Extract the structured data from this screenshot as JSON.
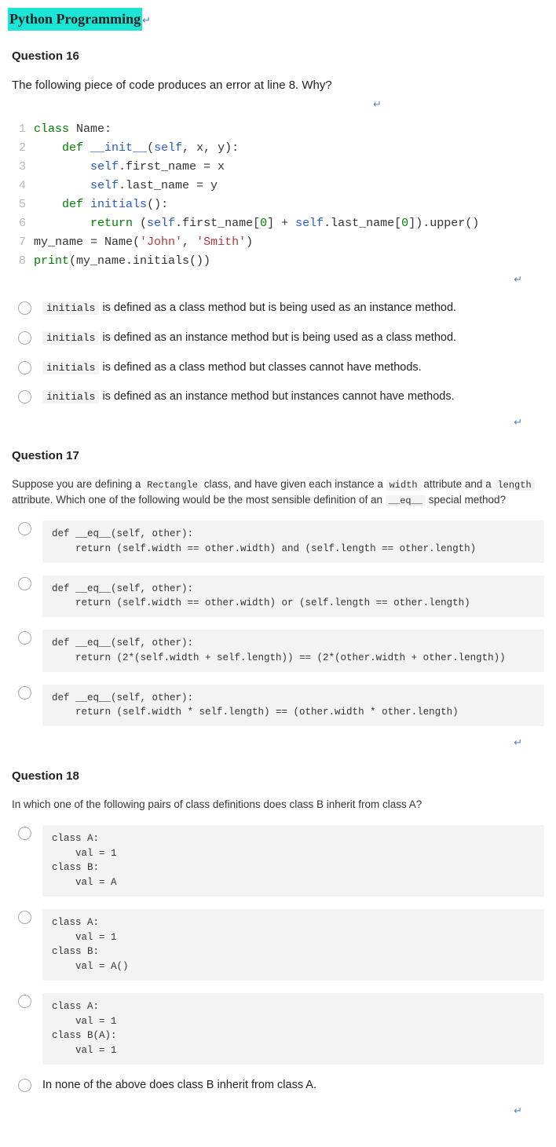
{
  "page_title": "Python Programming",
  "enter_glyph": "↵",
  "q16": {
    "heading": "Question 16",
    "prompt": "The following piece of code produces an error at line 8. Why?",
    "code": {
      "lines": [
        "1",
        "2",
        "3",
        "4",
        "5",
        "6",
        "7",
        "8"
      ]
    },
    "options": [
      {
        "code": "initials",
        "text": " is defined as a class method but is being used as an instance method."
      },
      {
        "code": "initials",
        "text": " is defined as an instance method but is being used as a class method."
      },
      {
        "code": "initials",
        "text": " is defined as a class method but classes cannot have methods."
      },
      {
        "code": "initials",
        "text": " is defined as an instance method but instances cannot have methods."
      }
    ]
  },
  "q17": {
    "heading": "Question 17",
    "prompt_pre": "Suppose you are defining a ",
    "prompt_c1": "Rectangle",
    "prompt_mid1": " class, and have given each instance a ",
    "prompt_c2": "width",
    "prompt_mid2": " attribute and a ",
    "prompt_c3": "length",
    "prompt_mid3": " attribute. Which one of the following would be the most sensible definition of an ",
    "prompt_c4": "__eq__",
    "prompt_post": " special method?",
    "options": [
      "def __eq__(self, other):\n    return (self.width == other.width) and (self.length == other.length)",
      "def __eq__(self, other):\n    return (self.width == other.width) or (self.length == other.length)",
      "def __eq__(self, other):\n    return (2*(self.width + self.length)) == (2*(other.width + other.length))",
      "def __eq__(self, other):\n    return (self.width * self.length) == (other.width * other.length)"
    ]
  },
  "q18": {
    "heading": "Question 18",
    "prompt": "In which one of the following pairs of class definitions does class B inherit from class A?",
    "options": [
      "class A:\n    val = 1\nclass B:\n    val = A",
      "class A:\n    val = 1\nclass B:\n    val = A()",
      "class A:\n    val = 1\nclass B(A):\n    val = 1"
    ],
    "option4": "In none of the above does class B inherit from class A."
  }
}
